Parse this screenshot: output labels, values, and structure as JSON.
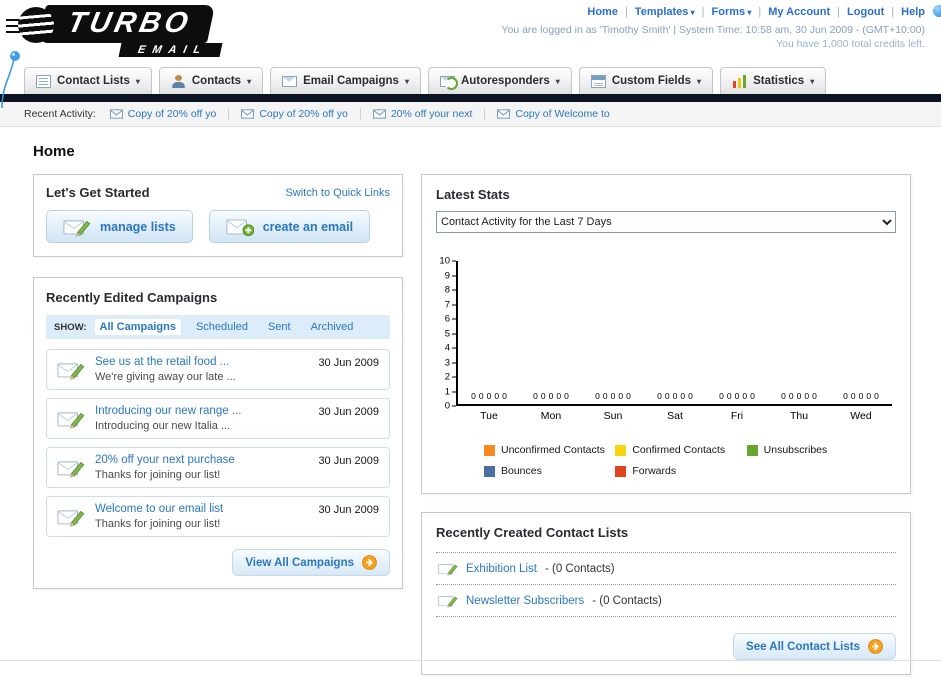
{
  "colors": {
    "link_blue": "#2a77c0",
    "dark_bar": "#0c1322",
    "accent_orange": "#f6a21d"
  },
  "logo": {
    "title": "TURBO",
    "subtitle": "EMAIL"
  },
  "utility_nav": {
    "links": [
      {
        "label": "Home",
        "dropdown": false
      },
      {
        "label": "Templates",
        "dropdown": true
      },
      {
        "label": "Forms",
        "dropdown": true
      },
      {
        "label": "My Account",
        "dropdown": false
      },
      {
        "label": "Logout",
        "dropdown": false
      },
      {
        "label": "Help",
        "dropdown": false
      }
    ],
    "session_line": "You are logged in as 'Timothy Smith' | System Time: 10:58 am, 30 Jun 2009 - (GMT+10:00)",
    "credits_line": "You have 1,000 total credits left."
  },
  "main_nav": {
    "tabs": [
      {
        "id": "contact-lists",
        "label": "Contact Lists",
        "icon": "contact-lists-icon"
      },
      {
        "id": "contacts",
        "label": "Contacts",
        "icon": "contacts-icon"
      },
      {
        "id": "email-campaigns",
        "label": "Email Campaigns",
        "icon": "email-campaigns-icon"
      },
      {
        "id": "autoresponders",
        "label": "Autoresponders",
        "icon": "autoresponders-icon"
      },
      {
        "id": "custom-fields",
        "label": "Custom Fields",
        "icon": "custom-fields-icon"
      },
      {
        "id": "statistics",
        "label": "Statistics",
        "icon": "statistics-icon"
      }
    ]
  },
  "recent_activity": {
    "label": "Recent Activity:",
    "items": [
      "Copy of 20% off yo",
      "Copy of 20% off yo",
      "20% off your next",
      "Copy of Welcome to"
    ]
  },
  "page": {
    "title": "Home"
  },
  "get_started": {
    "title": "Let's Get Started",
    "switch_link": "Switch to Quick Links",
    "manage_lists_label": "manage lists",
    "create_email_label": "create an email"
  },
  "campaigns": {
    "title": "Recently Edited Campaigns",
    "show_label": "SHOW:",
    "filters": [
      {
        "label": "All Campaigns",
        "selected": true
      },
      {
        "label": "Scheduled",
        "selected": false
      },
      {
        "label": "Sent",
        "selected": false
      },
      {
        "label": "Archived",
        "selected": false
      }
    ],
    "items": [
      {
        "title": "See us at the retail food ...",
        "subtitle": "We're giving away our late ...",
        "date": "30 Jun 2009"
      },
      {
        "title": "Introducing our new range ...",
        "subtitle": "Introducing our new Italia ...",
        "date": "30 Jun 2009"
      },
      {
        "title": "20% off your next purchase",
        "subtitle": "Thanks for joining our list!",
        "date": "30 Jun 2009"
      },
      {
        "title": "Welcome to our email list",
        "subtitle": "Thanks for joining our list!",
        "date": "30 Jun 2009"
      }
    ],
    "view_all_label": "View All Campaigns"
  },
  "stats": {
    "title": "Latest Stats",
    "selector_value": "Contact Activity for the Last 7 Days"
  },
  "chart_data": {
    "type": "bar",
    "title": "Contact Activity for the Last 7 Days",
    "categories": [
      "Tue",
      "Mon",
      "Sun",
      "Sat",
      "Fri",
      "Thu",
      "Wed"
    ],
    "series": [
      {
        "name": "Unconfirmed Contacts",
        "color": "#f6891f",
        "values": [
          0,
          0,
          0,
          0,
          0,
          0,
          0
        ]
      },
      {
        "name": "Confirmed Contacts",
        "color": "#f8d411",
        "values": [
          0,
          0,
          0,
          0,
          0,
          0,
          0
        ]
      },
      {
        "name": "Unsubscribes",
        "color": "#67a72e",
        "values": [
          0,
          0,
          0,
          0,
          0,
          0,
          0
        ]
      },
      {
        "name": "Bounces",
        "color": "#4a6fa5",
        "values": [
          0,
          0,
          0,
          0,
          0,
          0,
          0
        ]
      },
      {
        "name": "Forwards",
        "color": "#e2431e",
        "values": [
          0,
          0,
          0,
          0,
          0,
          0,
          0
        ]
      }
    ],
    "ylim": [
      0,
      10
    ],
    "yticks": [
      0,
      1,
      2,
      3,
      4,
      5,
      6,
      7,
      8,
      9,
      10
    ],
    "grid": false,
    "legend_position": "bottom"
  },
  "contact_lists": {
    "title": "Recently Created Contact Lists",
    "items": [
      {
        "name": "Exhibition List",
        "detail": " - (0 Contacts)"
      },
      {
        "name": "Newsletter Subscribers",
        "detail": " - (0 Contacts)"
      }
    ],
    "see_all_label": "See All Contact Lists"
  }
}
